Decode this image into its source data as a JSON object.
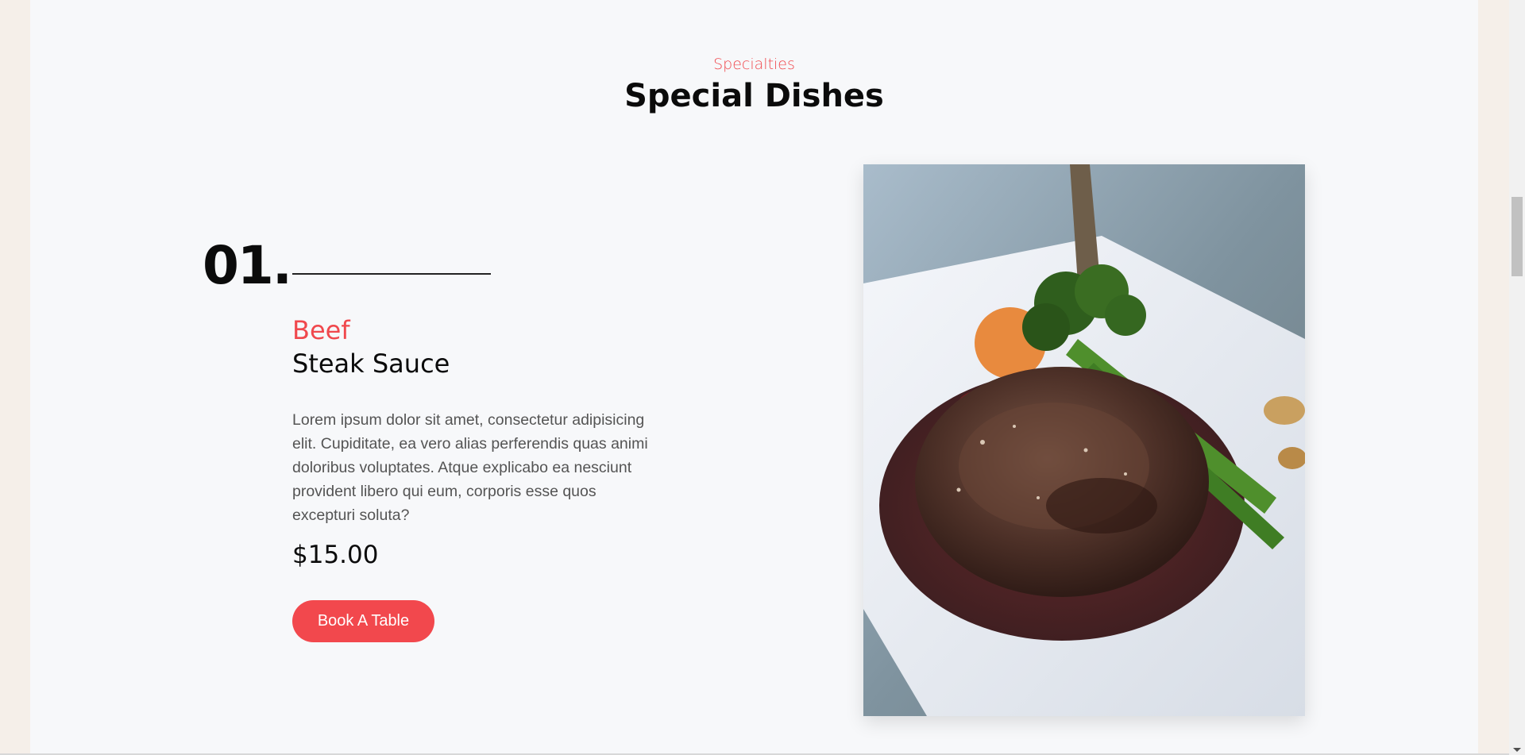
{
  "section": {
    "eyebrow": "Specialties",
    "title": "Special Dishes"
  },
  "dish": {
    "number": "01.",
    "category": "Beef",
    "name": "Steak Sauce",
    "description": "Lorem ipsum dolor sit amet, consectetur adipisicing elit. Cupiditate, ea vero alias perferendis quas animi doloribus voluptates. Atque explicabo ea nesciunt provident libero qui eum, corporis esse quos excepturi soluta?",
    "price": "$15.00",
    "button_label": "Book A Table",
    "image_icon": "steak-dish-photo"
  },
  "colors": {
    "accent": "#f2484d",
    "page_bg": "#f7f8fa",
    "outer_bg": "#f5efe9",
    "text_dark": "#0b0b0b",
    "text_body": "#545454"
  }
}
